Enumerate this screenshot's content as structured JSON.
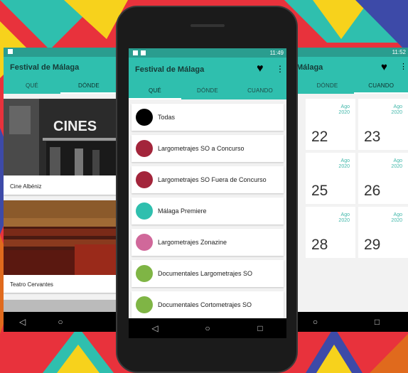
{
  "app": {
    "title": "Festival de Málaga"
  },
  "colors": {
    "teal": "#2fbfae",
    "teal_dark": "#2a9d8f",
    "accent_text": "#40b7aa"
  },
  "tabs": [
    "QUÉ",
    "DÓNDE",
    "CUANDO"
  ],
  "status": {
    "left_time": "11:49",
    "right_time": "11:52"
  },
  "venues": [
    {
      "label": "Cine Albéniz",
      "sign": "CINES"
    },
    {
      "label": "Teatro Cervantes"
    }
  ],
  "categories": [
    {
      "label": "Todas",
      "color": "#000000"
    },
    {
      "label": "Largometrajes SO a Concurso",
      "color": "#a3253b"
    },
    {
      "label": "Largometrajes SO Fuera de Concurso",
      "color": "#a3253b"
    },
    {
      "label": "Málaga Premiere",
      "color": "#2fbfae"
    },
    {
      "label": "Largometrajes Zonazine",
      "color": "#d0689a"
    },
    {
      "label": "Documentales Largometrajes SO",
      "color": "#7fb545"
    },
    {
      "label": "Documentales Cortometrajes SO",
      "color": "#7fb545"
    }
  ],
  "calendar": {
    "month": "Ago",
    "year": "2020",
    "days": [
      "22",
      "23",
      "25",
      "26",
      "28",
      "29"
    ]
  },
  "icons": {
    "favorite": "heart-icon",
    "menu": "more-vert-icon",
    "back": "nav-back-icon",
    "home": "nav-home-icon",
    "recents": "nav-recents-icon"
  }
}
